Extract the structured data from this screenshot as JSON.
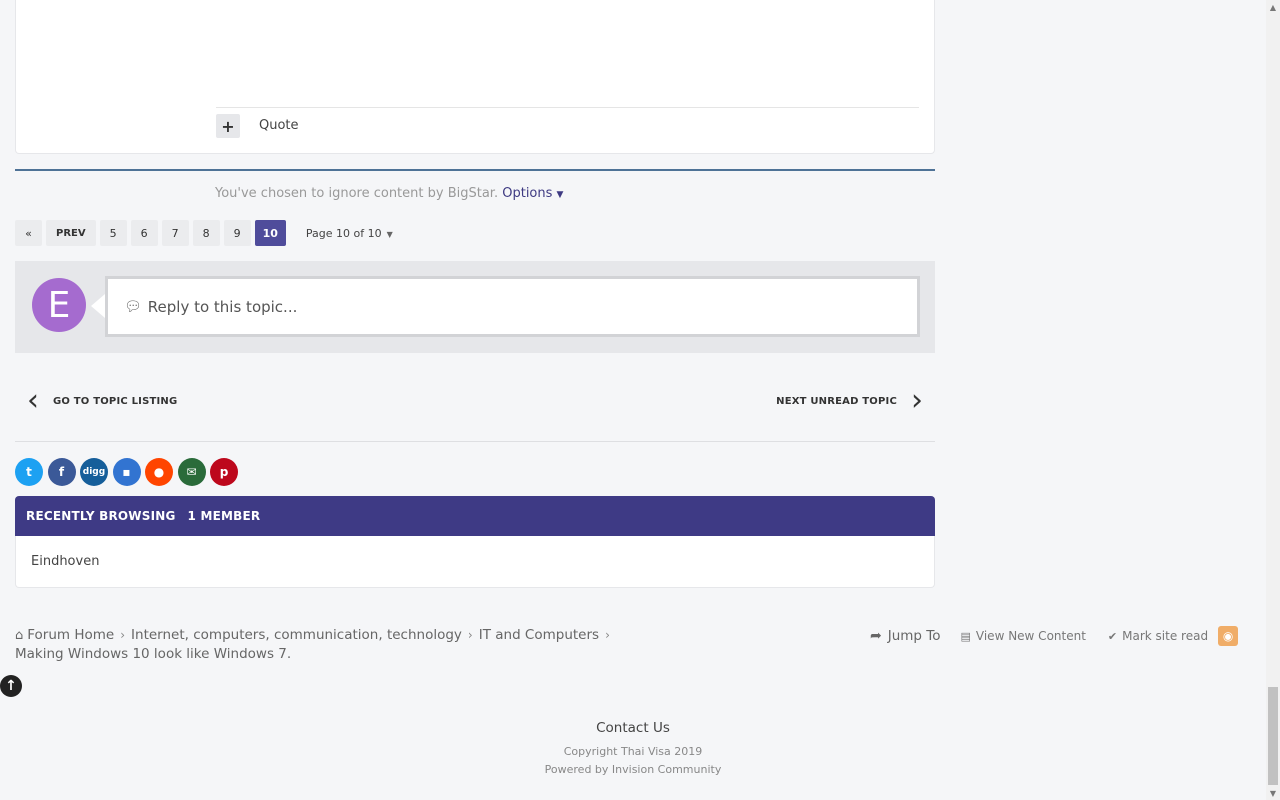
{
  "post": {
    "quote_label": "Quote",
    "multiquote_symbol": "+"
  },
  "ignored": {
    "text": "You've chosen to ignore content by BigStar.",
    "options_label": "Options"
  },
  "pagination": {
    "first_symbol": "«",
    "prev_label": "PREV",
    "pages": [
      "5",
      "6",
      "7",
      "8",
      "9",
      "10"
    ],
    "active_page": "10",
    "page_info": "Page 10 of 10"
  },
  "reply": {
    "avatar_letter": "E",
    "avatar_color": "#a56bcf",
    "placeholder": "Reply to this topic..."
  },
  "topic_nav": {
    "prev_label": "GO TO TOPIC LISTING",
    "next_label": "NEXT UNREAD TOPIC"
  },
  "share": [
    {
      "name": "twitter",
      "symbol": "t",
      "color": "#1da1f2"
    },
    {
      "name": "facebook",
      "symbol": "f",
      "color": "#3b5998"
    },
    {
      "name": "digg",
      "symbol": "digg",
      "color": "#155e9a"
    },
    {
      "name": "delicious",
      "symbol": "▪",
      "color": "#3274d1"
    },
    {
      "name": "reddit",
      "symbol": "●",
      "color": "#ff4500"
    },
    {
      "name": "email",
      "symbol": "✉",
      "color": "#2a6b3a"
    },
    {
      "name": "pinterest",
      "symbol": "p",
      "color": "#bd081c"
    }
  ],
  "recently_browsing": {
    "title": "RECENTLY BROWSING",
    "count": "1 MEMBER",
    "members": [
      "Eindhoven"
    ]
  },
  "breadcrumb": {
    "items": [
      "Forum Home",
      "Internet, computers, communication, technology",
      "IT and Computers"
    ],
    "current": "Making Windows 10 look like Windows 7."
  },
  "footer_links": {
    "jump_to": "Jump To",
    "view_new": "View New Content",
    "mark_read": "Mark site read"
  },
  "footer": {
    "contact": "Contact Us",
    "copyright": "Copyright Thai Visa 2019",
    "powered": "Powered by Invision Community"
  },
  "colors": {
    "accent": "#3e3a85",
    "active_page": "#4f4c9b",
    "divider_blue": "#4e7296",
    "rss": "#f0ad68"
  }
}
